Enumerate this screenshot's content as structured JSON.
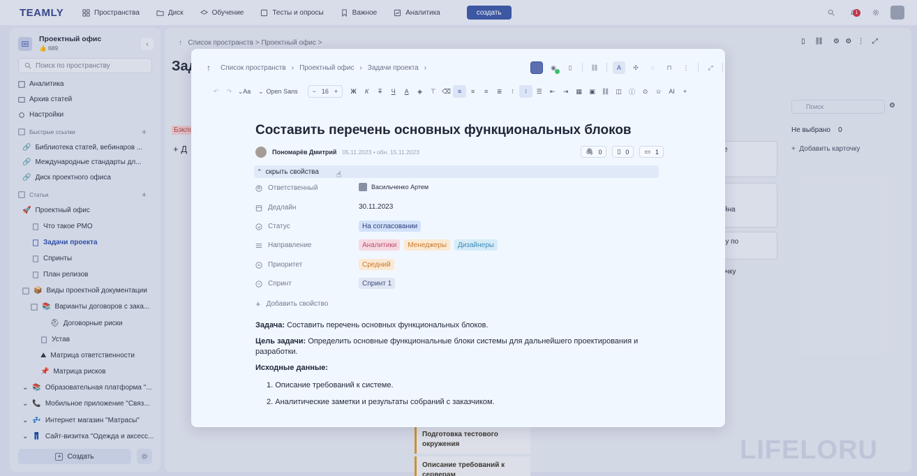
{
  "topbar": {
    "logo": "TEAMLY",
    "nav": [
      "Пространства",
      "Диск",
      "Обучение",
      "Тесты и опросы",
      "Важное",
      "Аналитика"
    ],
    "create_label": "создать",
    "notifications_count": "1"
  },
  "sidebar": {
    "space_name": "Проектный офис",
    "space_count": "689",
    "search_placeholder": "Поиск по пространству",
    "top_items": [
      "Аналитика",
      "Архив статей",
      "Настройки"
    ],
    "quick_links_label": "Быстрые ссылки",
    "quick_links": [
      "Библиотека статей, вебинаров ...",
      "Международные стандарты дл...",
      "Диск проектного офиса"
    ],
    "articles_label": "Статьи",
    "tree": [
      "Проектный офис",
      "Что такое PMO",
      "Задачи проекта",
      "Спринты",
      "План релизов",
      "Виды проектной документации",
      "Варианты договоров с зака...",
      "Договорные риски",
      "Устав",
      "Матрица ответственности",
      "Матрица рисков",
      "Образовательная платформа \"...",
      "Мобильное приложение \"Связ...",
      "Интернет магазин \"Матрасы\"",
      "Сайт-визитка \"Одежда и аксесс..."
    ],
    "create_label": "Создать"
  },
  "background": {
    "breadcrumb": "Список пространств > Проектный офис >",
    "title": "Зада",
    "search_placeholder": "Поиск",
    "not_selected": "Не выбрано",
    "not_selected_count": "0",
    "add_card": "Добавить карточку",
    "frag_backlog": "Бэклог",
    "frag_d": "Д",
    "frag_e": "е",
    "frag_ayna": "йна",
    "frag_dachu": "дачу по",
    "frag_tochku": "точку",
    "task1": "Подготовка тестового окружения",
    "task2": "Описание требований к серверам",
    "watermark": "LIFELORU"
  },
  "modal": {
    "breadcrumb": [
      "Список пространств",
      "Проектный офис",
      "Задачи проекта"
    ],
    "toolbar": {
      "font": "Open Sans",
      "size": "16",
      "bold": "Ж",
      "italic": "К",
      "strike": "Т",
      "underline": "Ч",
      "color": "A",
      "ai": "AI"
    },
    "title": "Составить перечень основных функциональных блоков",
    "author": "Пономарёв Дмитрий",
    "dates": "05.11.2023 • обн. 15.11.2023",
    "counters": [
      "0",
      "0",
      "1"
    ],
    "hide_props": "скрыть свойства",
    "props": {
      "assignee_label": "Ответственный",
      "assignee": "Васильченко Артем",
      "deadline_label": "Дедлайн",
      "deadline": "30.11.2023",
      "status_label": "Статус",
      "status": "На согласовании",
      "direction_label": "Направление",
      "directions": [
        "Аналитики",
        "Менеджеры",
        "Дизайнеры"
      ],
      "priority_label": "Приоритет",
      "priority": "Средний",
      "sprint_label": "Спринт",
      "sprint": "Спринт 1",
      "add_prop": "Добавить свойство"
    },
    "body": {
      "task_label": "Задача:",
      "task_text": "Составить перечень основных функциональных блоков.",
      "goal_label": "Цель задачи:",
      "goal_text": "Определить основные функциональные блоки системы для дальнейшего проектирования и разработки.",
      "input_label": "Исходные данные:",
      "list": [
        "Описание требований к системе.",
        "Аналитические заметки и результаты собраний с заказчиком."
      ]
    }
  },
  "colors": {
    "accent": "#3f5ba8",
    "status_bg": "#d3e2f9",
    "tag_analytics": "#f6d9e2",
    "tag_managers": "#fbe9d3",
    "tag_designers": "#d5ecf8",
    "priority_bg": "#fbe9d3",
    "sprint_bg": "#e0e6f4"
  }
}
